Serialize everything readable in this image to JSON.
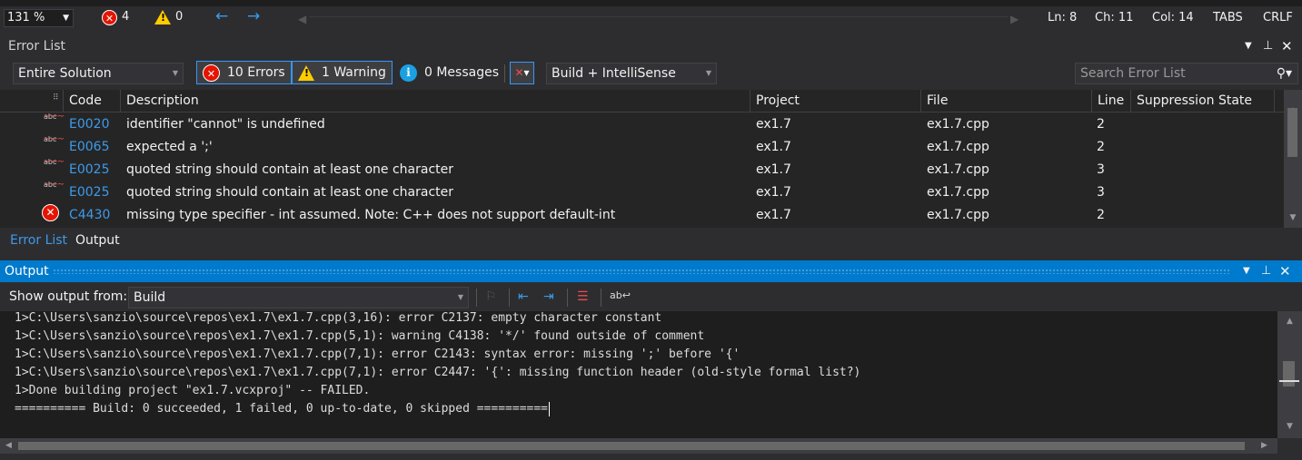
{
  "topbar": {
    "zoom": "131 %",
    "errors_count": "4",
    "warnings_count": "0",
    "ln": "Ln: 8",
    "ch": "Ch: 11",
    "col": "Col: 14",
    "tabs": "TABS",
    "eol": "CRLF"
  },
  "error_list": {
    "title": "Error List",
    "scope": "Entire Solution",
    "errors_btn": "10 Errors",
    "warnings_btn": "1 Warning",
    "messages_btn": "0 Messages",
    "build_filter": "Build + IntelliSense",
    "search_placeholder": "Search Error List",
    "columns": {
      "code": "Code",
      "description": "Description",
      "project": "Project",
      "file": "File",
      "line": "Line",
      "suppression": "Suppression State"
    },
    "rows": [
      {
        "icon": "spell-error-icon",
        "code": "E0020",
        "description": "identifier \"cannot\" is undefined",
        "project": "ex1.7",
        "file": "ex1.7.cpp",
        "line": "2"
      },
      {
        "icon": "spell-error-icon",
        "code": "E0065",
        "description": "expected a ';'",
        "project": "ex1.7",
        "file": "ex1.7.cpp",
        "line": "2"
      },
      {
        "icon": "spell-error-icon",
        "code": "E0025",
        "description": "quoted string should contain at least one character",
        "project": "ex1.7",
        "file": "ex1.7.cpp",
        "line": "3"
      },
      {
        "icon": "spell-error-icon",
        "code": "E0025",
        "description": "quoted string should contain at least one character",
        "project": "ex1.7",
        "file": "ex1.7.cpp",
        "line": "3"
      },
      {
        "icon": "error-circle-icon",
        "code": "C4430",
        "description": "missing type specifier - int assumed. Note: C++ does not support default-int",
        "project": "ex1.7",
        "file": "ex1.7.cpp",
        "line": "2"
      }
    ],
    "tabs": [
      "Error List",
      "Output"
    ]
  },
  "output": {
    "title": "Output",
    "show_from_label": "Show output from:",
    "source": "Build",
    "lines": [
      "1>C:\\Users\\sanzio\\source\\repos\\ex1.7\\ex1.7.cpp(3,16): error C2137: empty character constant",
      "1>C:\\Users\\sanzio\\source\\repos\\ex1.7\\ex1.7.cpp(5,1): warning C4138: '*/' found outside of comment",
      "1>C:\\Users\\sanzio\\source\\repos\\ex1.7\\ex1.7.cpp(7,1): error C2143: syntax error: missing ';' before '{'",
      "1>C:\\Users\\sanzio\\source\\repos\\ex1.7\\ex1.7.cpp(7,1): error C2447: '{': missing function header (old-style formal list?)",
      "1>Done building project \"ex1.7.vcxproj\" -- FAILED.",
      "========== Build: 0 succeeded, 1 failed, 0 up-to-date, 0 skipped =========="
    ]
  },
  "colors": {
    "accent": "#007acc",
    "error": "#e51400",
    "warning": "#ffcc00",
    "link": "#3e9ae9"
  }
}
